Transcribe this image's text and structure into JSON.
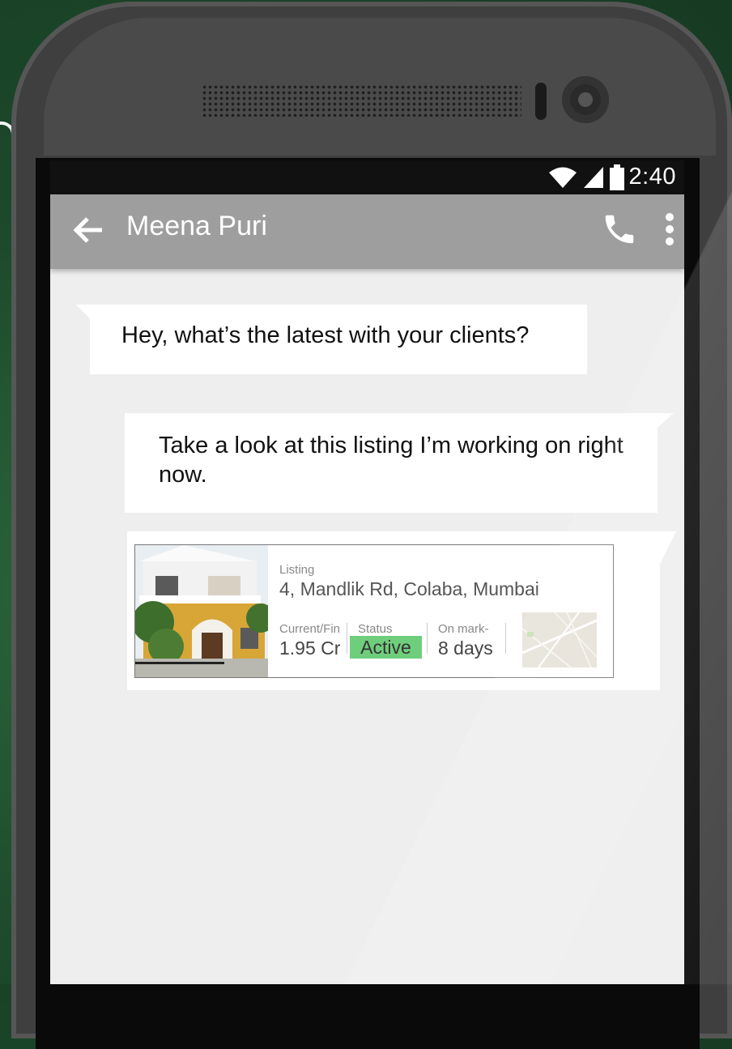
{
  "status_bar": {
    "time": "2:40",
    "icons": [
      "wifi-icon",
      "signal-icon",
      "battery-icon"
    ]
  },
  "app_bar": {
    "title": "Meena Puri",
    "back_icon": "arrow-left-icon",
    "call_icon": "phone-icon",
    "menu_icon": "more-vert-icon"
  },
  "messages": [
    {
      "direction": "incoming",
      "text": "Hey, what’s the latest with your clients?"
    },
    {
      "direction": "outgoing",
      "text": "Take a look at this listing I’m working on right now."
    }
  ],
  "listing_card": {
    "label": "Listing",
    "address": "4, Mandlik Rd, Colaba, Mumbai",
    "price_label": "Current/Fin",
    "price_value": "1.95 Cr",
    "status_label": "Status",
    "status_value": "Active",
    "market_label": "On mark-",
    "market_value": "8 days",
    "status_color": "#6fce7c"
  },
  "colors": {
    "background": "#1d4a2b",
    "app_bar": "#9e9e9e",
    "chat_background": "#eeeeee"
  }
}
